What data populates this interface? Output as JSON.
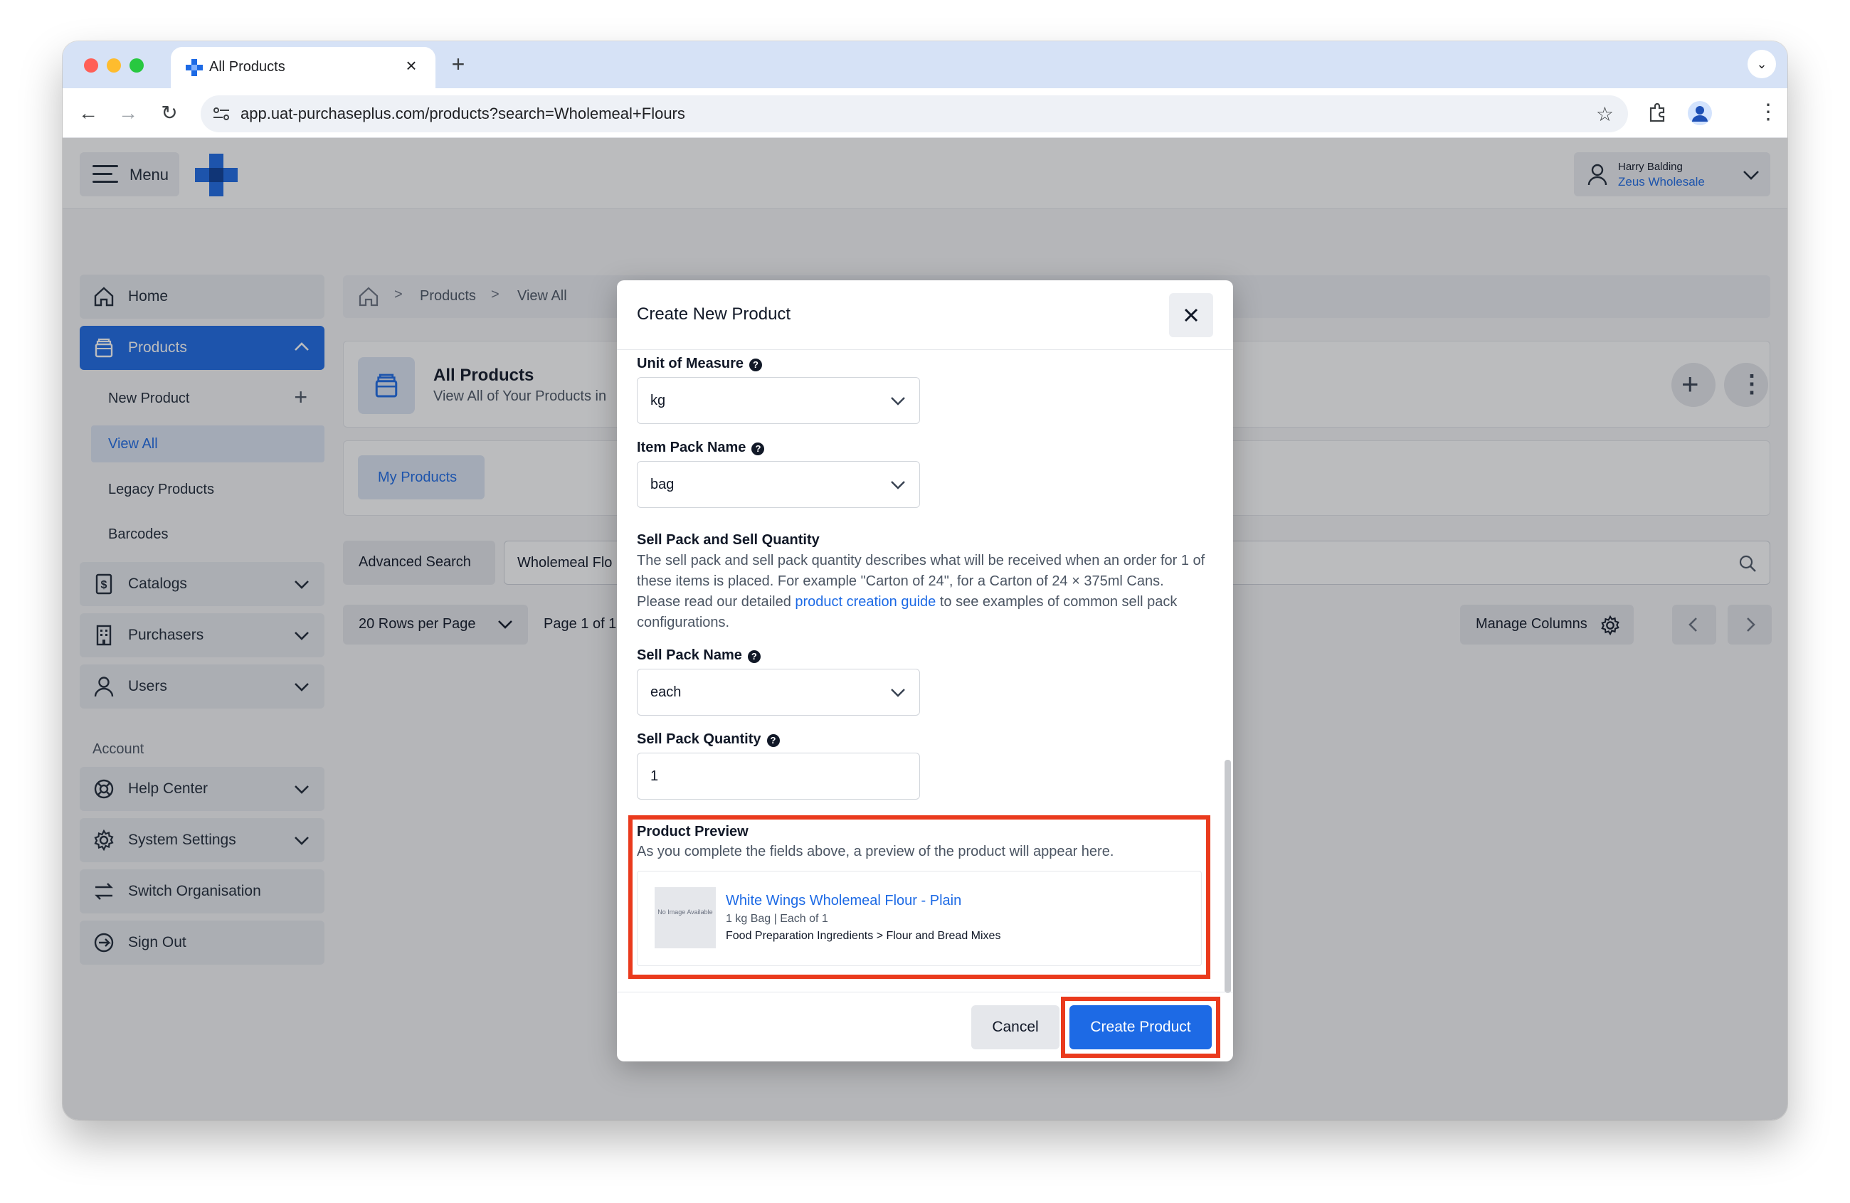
{
  "browser": {
    "tab_title": "All Products",
    "url": "app.uat-purchaseplus.com/products?search=Wholemeal+Flours"
  },
  "header": {
    "menu_label": "Menu",
    "user_name": "Harry Balding",
    "organisation": "Zeus Wholesale"
  },
  "sidebar": {
    "items": [
      {
        "label": "Home",
        "icon": "home-icon"
      },
      {
        "label": "Products",
        "icon": "box-icon"
      },
      {
        "label": "Catalogs",
        "icon": "dollar-icon"
      },
      {
        "label": "Purchasers",
        "icon": "building-icon"
      },
      {
        "label": "Users",
        "icon": "user-icon"
      }
    ],
    "sub_items": [
      "New Product",
      "View All",
      "Legacy Products",
      "Barcodes"
    ],
    "account_heading": "Account",
    "account_items": [
      {
        "label": "Help Center",
        "icon": "lifebuoy-icon"
      },
      {
        "label": "System Settings",
        "icon": "gear-icon"
      },
      {
        "label": "Switch Organisation",
        "icon": "switch-icon"
      },
      {
        "label": "Sign Out",
        "icon": "sign-out-icon"
      }
    ]
  },
  "main": {
    "breadcrumb": [
      "Products",
      "View All"
    ],
    "page_title": "All Products",
    "page_subtitle": "View All of Your Products in",
    "tab_my_products": "My Products",
    "advanced_search": "Advanced Search",
    "search_value": "Wholemeal Flo",
    "rows_per_page": "20 Rows per Page",
    "page_info": "Page 1 of 1",
    "manage_columns": "Manage Columns"
  },
  "modal": {
    "title": "Create New Product",
    "unit_of_measure_label": "Unit of Measure",
    "unit_of_measure_value": "kg",
    "item_pack_name_label": "Item Pack Name",
    "item_pack_name_value": "bag",
    "sell_pack_heading": "Sell Pack and Sell Quantity",
    "sell_pack_desc_1": "The sell pack and sell pack quantity describes what will be received when an order for 1 of these items is placed. For example \"Carton of 24\", for a Carton of 24 × 375ml Cans. Please read our detailed ",
    "sell_pack_desc_link": "product creation guide",
    "sell_pack_desc_2": " to see examples of common sell pack configurations.",
    "sell_pack_name_label": "Sell Pack Name",
    "sell_pack_name_value": "each",
    "sell_pack_qty_label": "Sell Pack Quantity",
    "sell_pack_qty_value": "1",
    "preview_heading": "Product Preview",
    "preview_desc": "As you complete the fields above, a preview of the product will appear here.",
    "preview_image_text": "No Image Available",
    "preview_product_name": "White Wings Wholemeal Flour - Plain",
    "preview_pack": "1 kg Bag | Each of 1",
    "preview_category": "Food Preparation Ingredients > Flour and Bread Mixes",
    "cancel_label": "Cancel",
    "create_label": "Create Product"
  },
  "colors": {
    "primary": "#1d6ae5",
    "highlight": "#ea3a1d"
  }
}
